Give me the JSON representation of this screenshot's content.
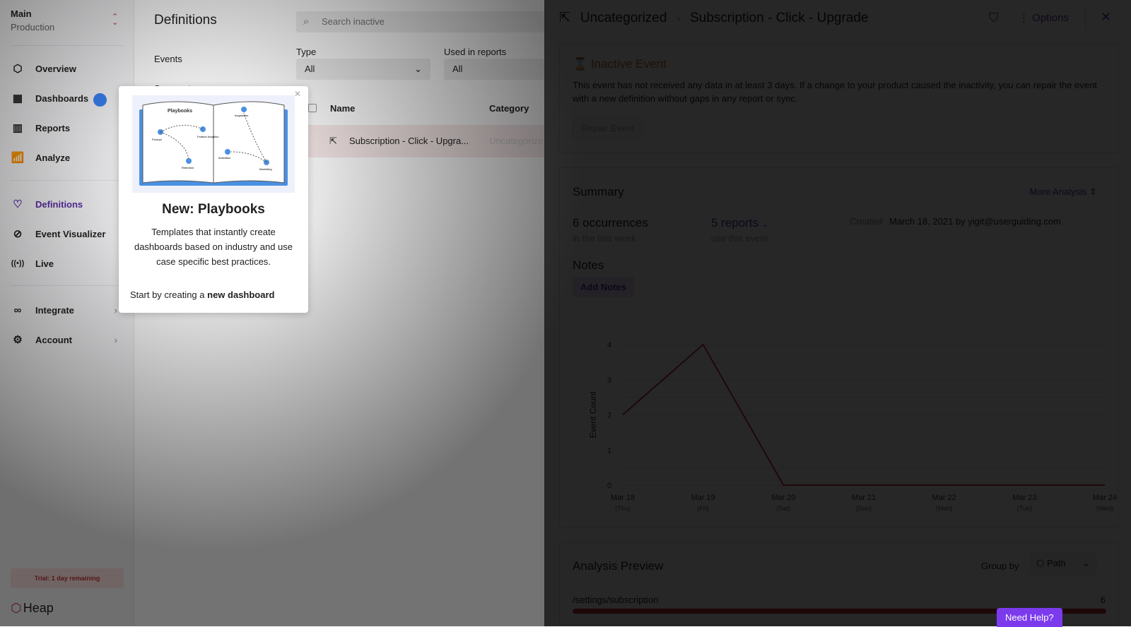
{
  "sidebar": {
    "env_name": "Main",
    "env_sub": "Production",
    "items": [
      {
        "label": "Overview",
        "icon": "hexagon-icon"
      },
      {
        "label": "Dashboards",
        "icon": "grid-icon"
      },
      {
        "label": "Reports",
        "icon": "report-icon"
      },
      {
        "label": "Analyze",
        "icon": "analyze-icon"
      },
      {
        "label": "Definitions",
        "icon": "definitions-icon"
      },
      {
        "label": "Event Visualizer",
        "icon": "visualizer-icon"
      },
      {
        "label": "Live",
        "icon": "live-icon"
      },
      {
        "label": "Integrate",
        "icon": "integrate-icon"
      },
      {
        "label": "Account",
        "icon": "account-icon"
      }
    ],
    "trial": "Trial: 1 day remaining",
    "logo": "Heap"
  },
  "definitions": {
    "title": "Definitions",
    "nav": [
      "Events",
      "Segments"
    ],
    "search_placeholder": "Search inactive",
    "type_label": "Type",
    "type_value": "All",
    "used_label": "Used in reports",
    "used_value": "All",
    "columns": [
      "Name",
      "Category"
    ],
    "rows": [
      {
        "name": "Subscription - Click - Upgra...",
        "category": "Uncategorize"
      }
    ]
  },
  "popup": {
    "title": "New: Playbooks",
    "description": "Templates that instantly create dashboards based on industry and use case specific best practices.",
    "cta_prefix": "Start by creating a ",
    "cta_bold": "new dashboard",
    "illustration": {
      "title": "Playbooks",
      "labels": [
        "Product",
        "Feature Adoption",
        "Retention",
        "Acquisition",
        "Activation",
        "Marketing"
      ]
    }
  },
  "detail": {
    "breadcrumb": [
      "Uncategorized",
      "Subscription - Click - Upgrade"
    ],
    "options": "Options",
    "inactive": {
      "title": "Inactive Event",
      "text": "This event has not received any data in at least 3 days. If a change to your product caused the inactivity, you can repair the event with a new definition without gaps in any report or sync.",
      "button": "Repair Event"
    },
    "summary": {
      "title": "Summary",
      "more": "More Analysis",
      "occurrences": "6 occurrences",
      "occ_sub": "in the last week",
      "reports": "5 reports",
      "reports_sub": "use this event",
      "created_label": "Created",
      "created_value": "March 18, 2021 by yigit@userguiding.com",
      "notes": "Notes",
      "add_notes": "Add Notes"
    },
    "preview": {
      "title": "Analysis Preview",
      "group_by": "Group by",
      "group_value": "Path",
      "path": "/settings/subscription",
      "count": "6"
    }
  },
  "chart_data": {
    "type": "line",
    "ylabel": "Event Count",
    "ylim": [
      0,
      4
    ],
    "yticks": [
      0,
      1,
      2,
      3,
      4
    ],
    "grid": true,
    "color": "#c0303a",
    "categories": [
      "Mar 18",
      "Mar 19",
      "Mar 20",
      "Mar 21",
      "Mar 22",
      "Mar 23",
      "Mar 24"
    ],
    "sublabels": [
      "(Thu)",
      "(Fri)",
      "(Sat)",
      "(Sun)",
      "(Mon)",
      "(Tue)",
      "(Wed)"
    ],
    "values": [
      2,
      4,
      0,
      0,
      0,
      0,
      0
    ]
  },
  "help": "Need Help?"
}
